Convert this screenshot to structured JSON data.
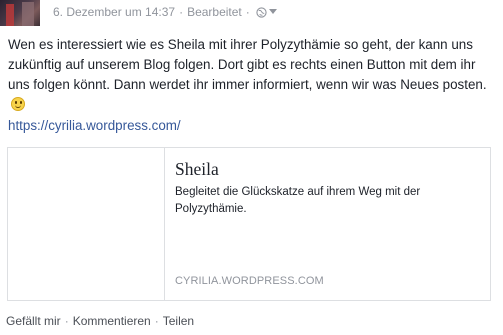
{
  "header": {
    "timestamp": "6. Dezember um 14:37",
    "separator": "·",
    "edited_label": "Bearbeitet",
    "audience_icon": "globe-icon",
    "audience_caret_icon": "caret-down-icon"
  },
  "post": {
    "text": "Wen es interessiert wie es Sheila mit ihrer Polyzythämie so geht, der kann uns zukünftig auf unserem Blog folgen. Dort gibt es rechts einen Button mit dem ihr uns folgen könnt. Dann werdet ihr immer informiert, wenn wir was Neues posten.",
    "emoji": "smile-emoji-icon",
    "link": "https://cyrilia.wordpress.com/"
  },
  "card": {
    "title": "Sheila",
    "description": "Begleitet die Glückskatze auf ihrem Weg mit der Polyzythämie.",
    "domain": "CYRILIA.WORDPRESS.COM"
  },
  "actions": {
    "like": "Gefällt mir",
    "comment": "Kommentieren",
    "share": "Teilen",
    "separator": "·"
  },
  "colors": {
    "text": "#1d2129",
    "meta": "#90949c",
    "link": "#365899",
    "border": "#dddfe2"
  }
}
